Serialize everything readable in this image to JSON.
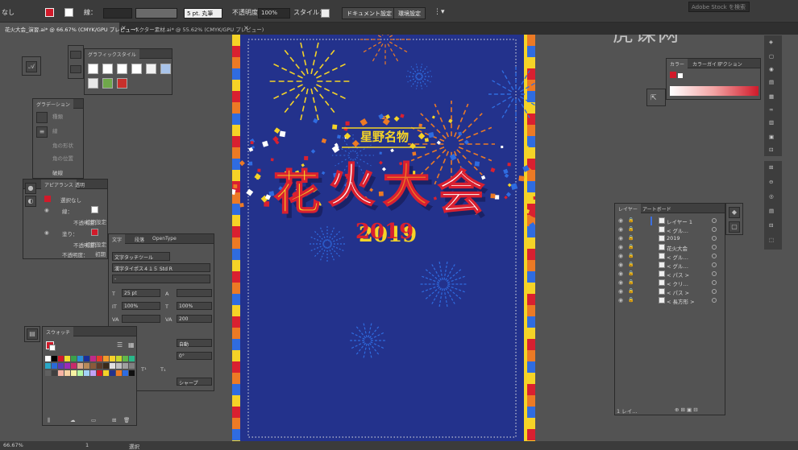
{
  "topbar": {
    "selection": "なし",
    "stroke_label": "線：",
    "brush": "5 pt. 丸筆",
    "opacity_label": "不透明度：",
    "opacity_value": "100%",
    "style_label": "スタイル：",
    "doc_settings": "ドキュメント設定",
    "env_settings": "環境設定",
    "search_placeholder": "Adobe Stock を検索"
  },
  "watermark": "虎课网",
  "tabs": [
    {
      "label": "花火大会_演習.ai* @ 66.67% (CMYK/GPU プレビュー)",
      "close": "×"
    },
    {
      "label": "ベクター素材.ai* @ 55.62% (CMYK/GPU プレビュー)",
      "close": "×"
    }
  ],
  "graphic_style": {
    "title": "グラフィックスタイル"
  },
  "gradient": {
    "title": "グラデーション",
    "rows": [
      "種類",
      "線",
      "角の形状",
      "角の位置"
    ]
  },
  "appearance": {
    "tabs": [
      "アピアランス",
      "透明"
    ],
    "selection": "選択なし",
    "stroke": "線：",
    "opacity1": "不透明度：",
    "opacity1_val": "初期設定",
    "fill": "塗り：",
    "opacity2": "不透明度：",
    "opacity2_val": "初期設定",
    "opacity3": "不透明度：",
    "opacity3_val": "初期",
    "side_label": "破線"
  },
  "character": {
    "tabs": [
      "文字",
      "段落",
      "OpenType"
    ],
    "touch_tool": "文字タッチツール",
    "font": "漢字タイポス４１５ Std R",
    "style": "-",
    "size": "25 pt",
    "leading": "",
    "vscale": "100%",
    "hscale": "100%",
    "kerning": "",
    "tracking": "200",
    "auto": "自動",
    "rotation": "0°",
    "aa": "シャープ"
  },
  "swatches": {
    "title": "スウォッチ"
  },
  "color_panel": {
    "tabs": [
      "カラー",
      "カラーガイド",
      "アクション"
    ]
  },
  "layers": {
    "tabs": [
      "レイヤー",
      "アートボード"
    ],
    "items": [
      {
        "name": "レイヤー 1",
        "level": 0
      },
      {
        "name": "< グル…",
        "level": 1
      },
      {
        "name": "2019",
        "level": 1
      },
      {
        "name": "花火大会",
        "level": 1
      },
      {
        "name": "< グル…",
        "level": 1
      },
      {
        "name": "< グル…",
        "level": 1
      },
      {
        "name": "< パス >",
        "level": 1
      },
      {
        "name": "< クリ…",
        "level": 1
      },
      {
        "name": "< パス >",
        "level": 1
      },
      {
        "name": "< 長方形 >",
        "level": 1
      }
    ],
    "footer": "1 レイ..."
  },
  "statusbar": {
    "zoom": "66.67%",
    "page": "1",
    "tool": "選択"
  },
  "poster": {
    "subtitle": "星野名物",
    "title_chars": [
      "花",
      "火",
      "大",
      "会"
    ],
    "year": "2019",
    "colors": {
      "bg": "#23328c",
      "yellow": "#f5d327",
      "red": "#d92030",
      "orange": "#ec7a25",
      "blue": "#2f6ce0"
    }
  }
}
